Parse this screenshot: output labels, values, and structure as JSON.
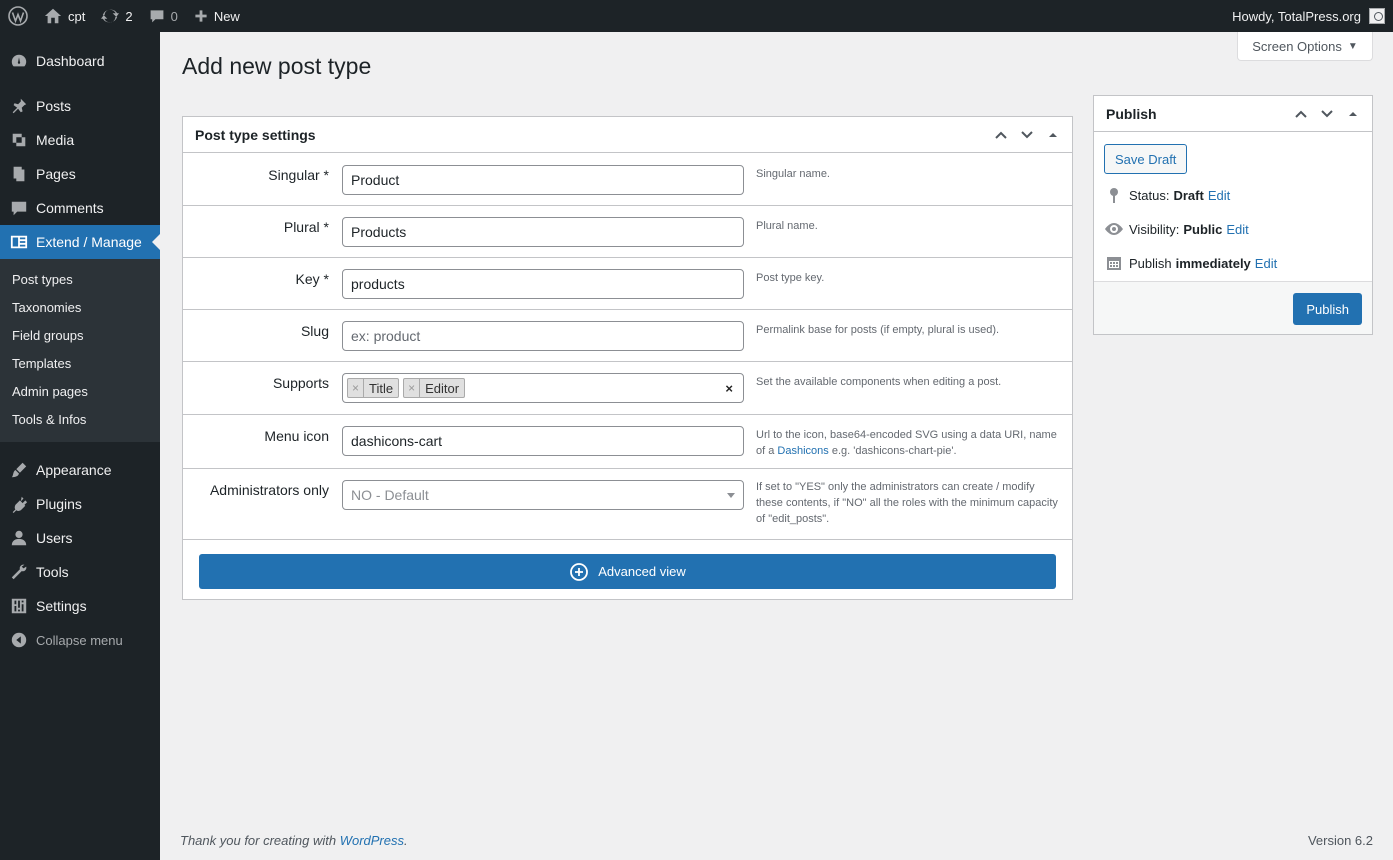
{
  "admin_bar": {
    "site_name": "cpt",
    "updates_count": "2",
    "comments_count": "0",
    "new_label": "New",
    "greeting": "Howdy, TotalPress.org"
  },
  "sidebar": {
    "items_top": [
      {
        "label": "Dashboard",
        "icon": "dashboard-icon"
      }
    ],
    "items_mid": [
      {
        "label": "Posts",
        "icon": "pushpin-icon"
      },
      {
        "label": "Media",
        "icon": "media-icon"
      },
      {
        "label": "Pages",
        "icon": "pages-icon"
      },
      {
        "label": "Comments",
        "icon": "comment-icon"
      },
      {
        "label": "Extend / Manage",
        "icon": "extend-icon",
        "current": true
      }
    ],
    "submenu": [
      "Post types",
      "Taxonomies",
      "Field groups",
      "Templates",
      "Admin pages",
      "Tools & Infos"
    ],
    "items_bottom": [
      {
        "label": "Appearance",
        "icon": "paintbrush-icon"
      },
      {
        "label": "Plugins",
        "icon": "plugin-icon"
      },
      {
        "label": "Users",
        "icon": "users-icon"
      },
      {
        "label": "Tools",
        "icon": "wrench-icon"
      },
      {
        "label": "Settings",
        "icon": "settings-icon"
      }
    ],
    "collapse_label": "Collapse menu"
  },
  "header": {
    "screen_options": "Screen Options",
    "page_title": "Add new post type"
  },
  "settings_box": {
    "title": "Post type settings",
    "fields": {
      "singular": {
        "label": "Singular *",
        "value": "Product",
        "desc": "Singular name."
      },
      "plural": {
        "label": "Plural *",
        "value": "Products",
        "desc": "Plural name."
      },
      "key": {
        "label": "Key *",
        "value": "products",
        "desc": "Post type key."
      },
      "slug": {
        "label": "Slug",
        "placeholder": "ex: product",
        "desc": "Permalink base for posts (if empty, plural is used)."
      },
      "supports": {
        "label": "Supports",
        "tokens": [
          "Title",
          "Editor"
        ],
        "desc": "Set the available components when editing a post."
      },
      "menu_icon": {
        "label": "Menu icon",
        "value": "dashicons-cart",
        "desc_before": "Url to the icon, base64-encoded SVG using a data URI, name of a",
        "desc_link": "Dashicons",
        "desc_after": "e.g. 'dashicons-chart-pie'."
      },
      "admin_only": {
        "label": "Administrators only",
        "selected": "NO - Default",
        "desc": "If set to \"YES\" only the administrators can create / modify these contents, if \"NO\" all the roles with the minimum capacity of \"edit_posts\"."
      }
    },
    "advanced_label": "Advanced view"
  },
  "publish_box": {
    "title": "Publish",
    "save_draft": "Save Draft",
    "status_label": "Status:",
    "status_value": "Draft",
    "visibility_label": "Visibility:",
    "visibility_value": "Public",
    "publish_label": "Publish",
    "publish_value": "immediately",
    "edit_label": "Edit",
    "publish_button": "Publish"
  },
  "footer": {
    "thanks_prefix": "Thank you for creating with",
    "thanks_link": "WordPress",
    "thanks_suffix": ".",
    "version": "Version 6.2"
  },
  "colors": {
    "accent": "#2271b1",
    "sidebar_bg": "#1d2327",
    "submenu_bg": "#2c3338",
    "page_bg": "#f0f0f1"
  }
}
